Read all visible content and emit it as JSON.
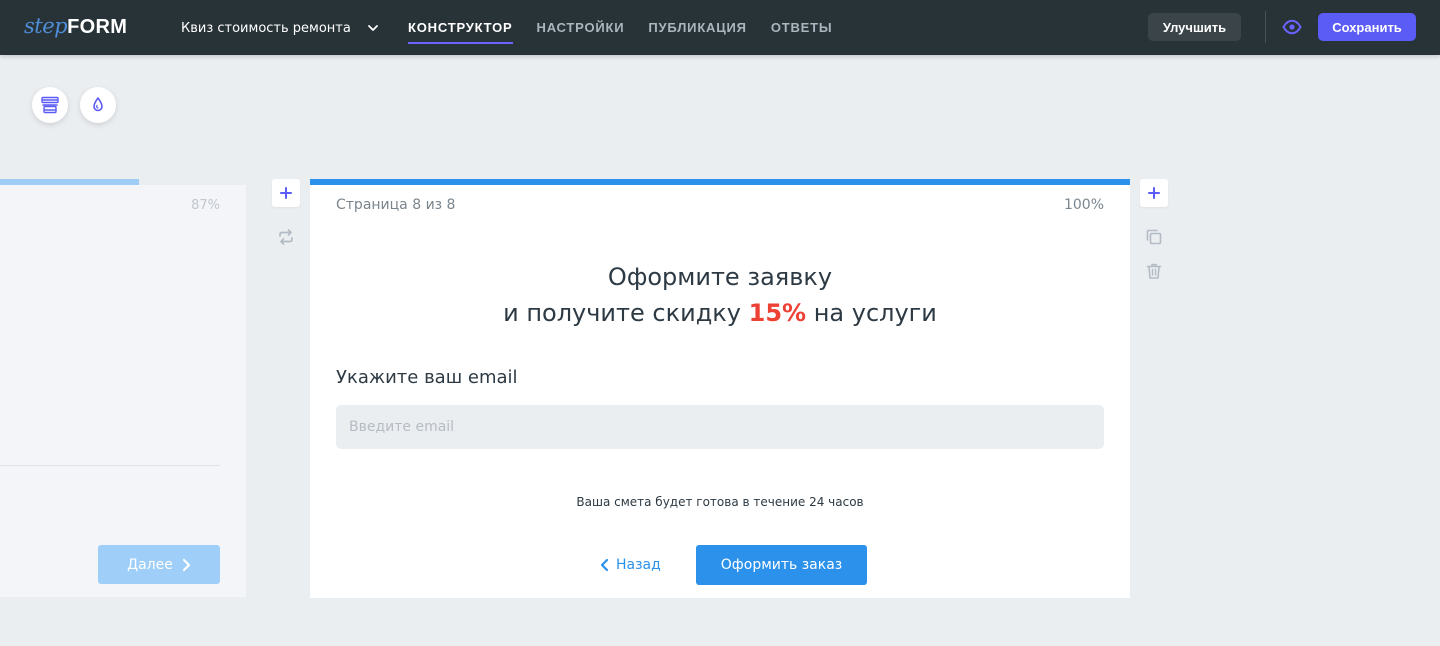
{
  "header": {
    "logo": {
      "part1": "step",
      "part2": "FORM"
    },
    "quiz_name": "Квиз стоимость ремонта",
    "tabs": [
      {
        "label": "КОНСТРУКТОР",
        "active": true
      },
      {
        "label": "НАСТРОЙКИ",
        "active": false
      },
      {
        "label": "ПУБЛИКАЦИЯ",
        "active": false
      },
      {
        "label": "ОТВЕТЫ",
        "active": false
      }
    ],
    "upgrade_label": "Улучшить",
    "save_label": "Сохранить"
  },
  "toolbar": {
    "icons": [
      "layout-icon",
      "color-drop-icon"
    ]
  },
  "prev_page": {
    "progress_percent": "87%",
    "next_label": "Далее"
  },
  "page": {
    "counter": "Страница 8 из 8",
    "progress_percent": "100%",
    "title_line1": "Оформите заявку",
    "title_line2_before": "и получите скидку ",
    "title_highlight": "15%",
    "title_line2_after": " на услуги",
    "question": "Укажите ваш email",
    "email_placeholder": "Введите email",
    "note": "Ваша смета будет готова в течение 24 часов",
    "back_label": "Назад",
    "submit_label": "Оформить заказ"
  },
  "colors": {
    "topbar": "#283338",
    "accent_purple": "#5b5bf5",
    "primary_blue": "#2b91ea",
    "highlight_red": "#ee4136",
    "background": "#ebeef1"
  }
}
